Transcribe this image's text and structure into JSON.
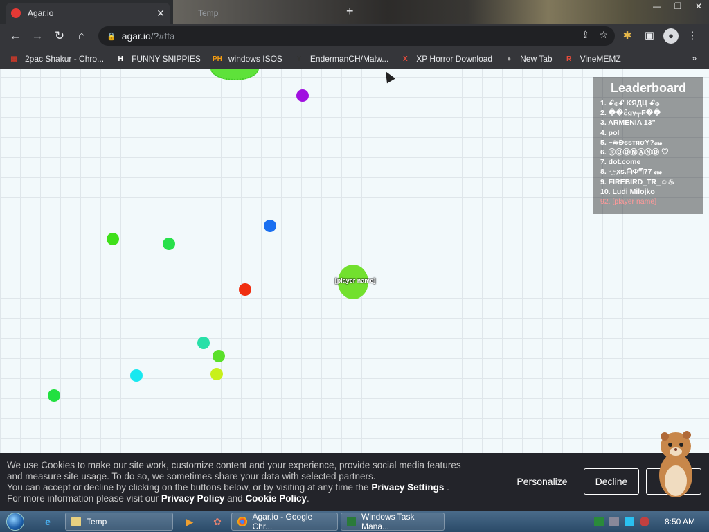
{
  "browser": {
    "tab_title": "Agar.io",
    "tab2_title": "Temp",
    "new_tab_icon": "plus-icon",
    "window_controls": [
      "—",
      "❐",
      "✕"
    ],
    "url_host": "agar.io",
    "url_path": "/?#ffa",
    "bookmarks": [
      {
        "label": "2pac Shakur - Chro...",
        "icon_text": "▦",
        "color": "#c0392b"
      },
      {
        "label": "FUNNY SNIPPIES",
        "icon_text": "H",
        "color": "#fff"
      },
      {
        "label": "windows ISOS",
        "icon_text": "PH",
        "color": "#f39c12"
      },
      {
        "label": "EndermanCH/Malw...",
        "icon_text": "Y",
        "color": "#333"
      },
      {
        "label": "XP Horror Download",
        "icon_text": "X",
        "color": "#e74c3c"
      },
      {
        "label": "New Tab",
        "icon_text": "●",
        "color": "#aaa"
      },
      {
        "label": "VineMEMZ",
        "icon_text": "R",
        "color": "#e74c3c"
      }
    ],
    "bookmarks_more": "»"
  },
  "game": {
    "player_name": "[player name]",
    "pellets": [
      {
        "color": "#a010e0"
      },
      {
        "color": "#1a6ff0"
      },
      {
        "color": "#3fe01a"
      },
      {
        "color": "#28e04a"
      },
      {
        "color": "#f02e10"
      },
      {
        "color": "#28e0a8"
      },
      {
        "color": "#5ae02a"
      },
      {
        "color": "#c8f01a"
      },
      {
        "color": "#18e8f0"
      },
      {
        "color": "#22e040"
      }
    ]
  },
  "leaderboard": {
    "title": "Leaderboard",
    "rows": [
      "1. ꗃ۞ꗃ KЯДЦ ꗃ۞",
      "2. ��ℰgy╤F��",
      "3. ARMENIA 13”",
      "4. pol",
      "5. ⌐≋ĐєѕтяσΥ?꘏",
      "6. ⓇⓄⓄⓃⒶⓃⒹ ♡",
      "7. dot.come",
      "8. ᵕ͈ ̮ᵕ͈xs.ᗩΦᘉ77 ꘏",
      "9. FIREBIRD_TR_☺♨",
      "10. Ludi Milojko"
    ],
    "me": "92. [player name]"
  },
  "cookie": {
    "line1": "We use Cookies to make our site work, customize content and your experience, provide social media features",
    "line2": "and measure site usage. To do so, we sometimes share your data with selected partners.",
    "line3_pre": "You can accept or decline by clicking on the buttons below, or by visiting at any time the ",
    "line3_link": "Privacy Settings",
    "line3_post": " .",
    "line4_pre": "For more information please visit our ",
    "privacy_policy": "Privacy Policy",
    "and": " and ",
    "cookie_policy": "Cookie Policy",
    "line4_post": ".",
    "personalize": "Personalize",
    "decline": "Decline",
    "accept": ""
  },
  "taskbar": {
    "tasks": [
      "Temp",
      "Agar.io - Google Chr...",
      "Windows Task Mana..."
    ],
    "clock": "8:50 AM"
  }
}
